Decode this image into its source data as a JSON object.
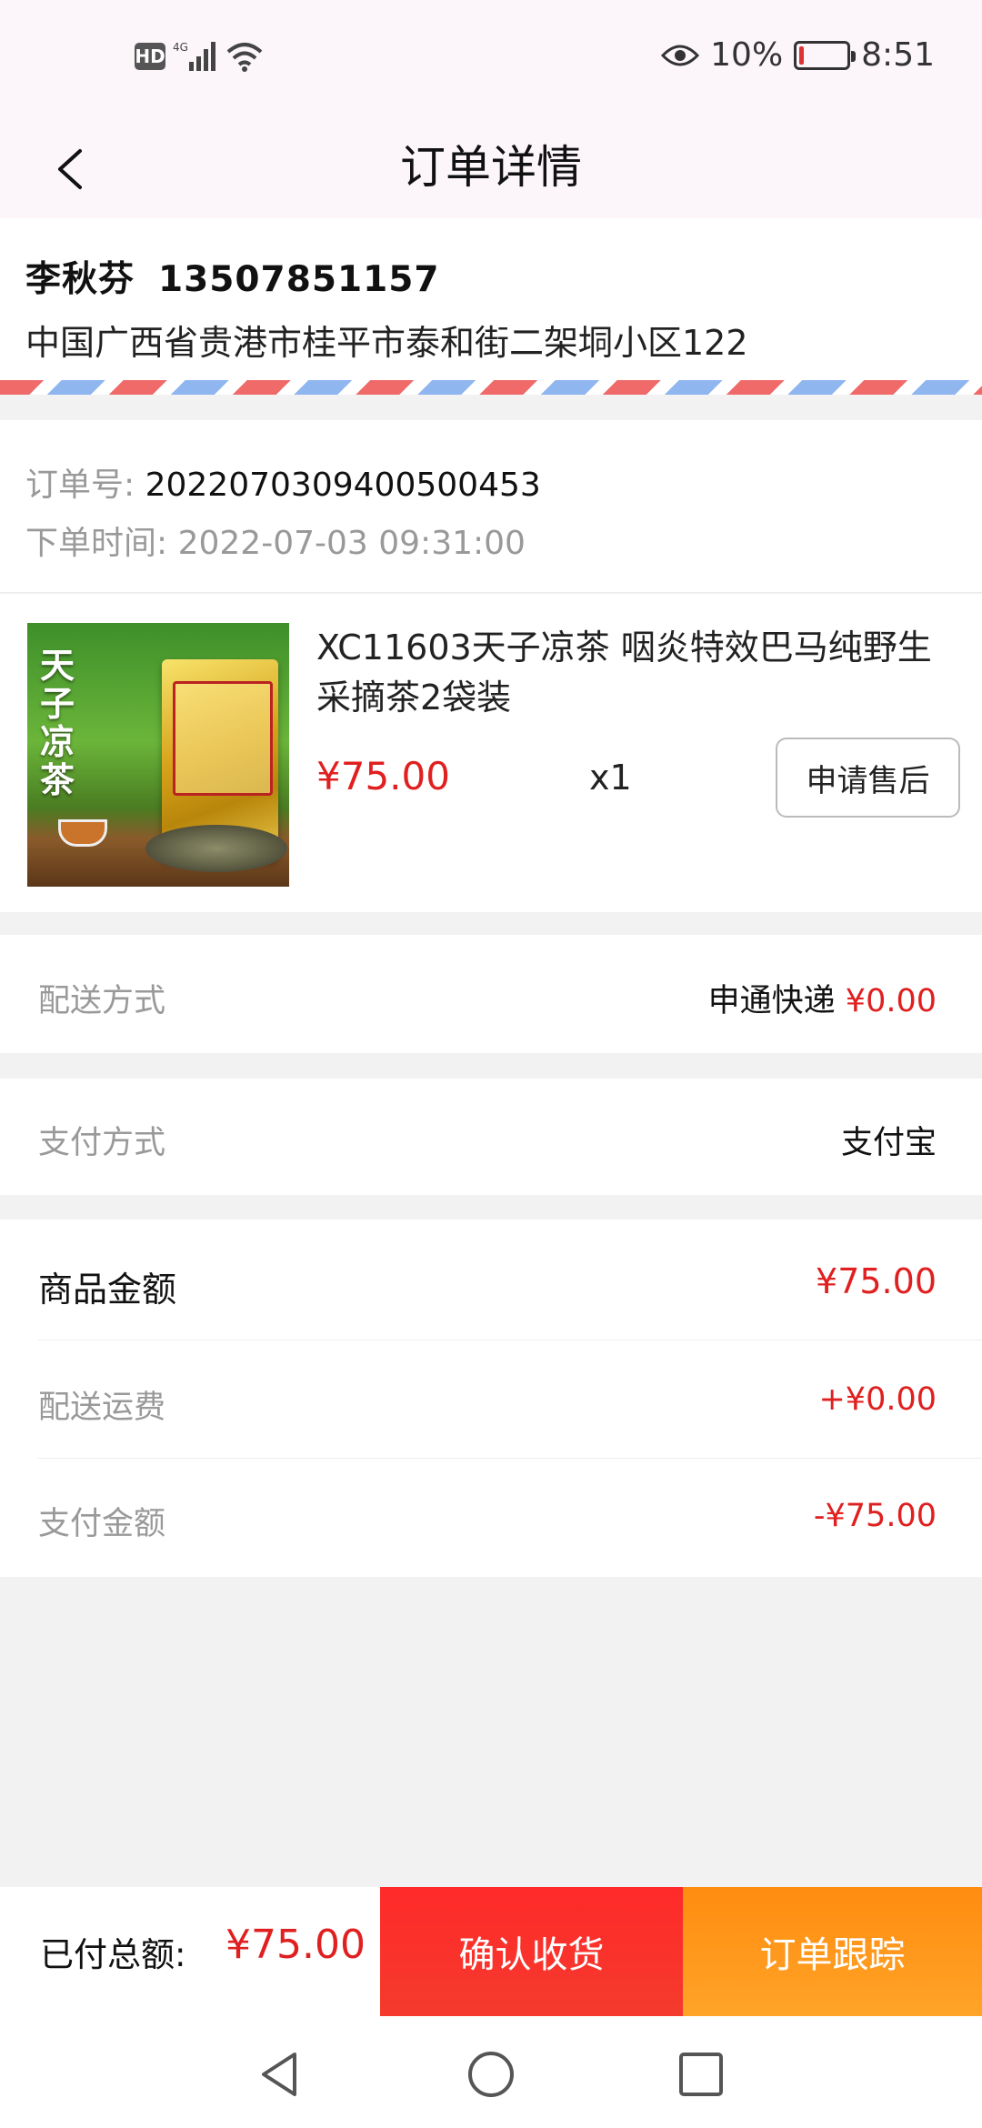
{
  "status_bar": {
    "hd": "HD",
    "network": "4G",
    "battery": "10%",
    "time": "8:51",
    "battery_level": 0.1,
    "icons": [
      "signal-icon",
      "wifi-icon",
      "eye-icon",
      "battery-icon"
    ]
  },
  "header": {
    "title": "订单详情",
    "back_icon": "back-arrow-icon"
  },
  "address": {
    "name": "李秋芬",
    "phone": "13507851157",
    "line": "中国广西省贵港市桂平市泰和街二架垌小区122"
  },
  "order": {
    "number_label": "订单号:",
    "number": "20220703094005004​53",
    "time_label": "下单时间:",
    "time": "2022-07-03 09:31:00"
  },
  "product": {
    "name": "XC11603天子凉茶 咽炎特效巴马纯野生采摘茶2袋装",
    "price": "¥75.00",
    "qty": "x1",
    "aftersale_label": "申请售后",
    "image_text": "天子凉茶"
  },
  "delivery": {
    "label": "配送方式",
    "method": "申通快递",
    "fee": "¥0.00"
  },
  "payment": {
    "label": "支付方式",
    "method": "支付宝"
  },
  "summary": {
    "goods_label": "商品金额",
    "goods_value": "¥75.00",
    "shipping_label": "配送运费",
    "shipping_value": "+¥0.00",
    "paid_label": "支付金额",
    "paid_value": "-¥75.00"
  },
  "footer": {
    "total_label": "已付总额:",
    "total_value": "¥75.00",
    "confirm_label": "确认收货",
    "track_label": "订单跟踪"
  },
  "nav": {
    "icons": [
      "nav-back-icon",
      "nav-home-icon",
      "nav-recents-icon"
    ]
  },
  "colors": {
    "accent_red": "#e02020",
    "button_red": "#ff2a2a",
    "button_orange": "#ff8c10",
    "airmail_red": "#f06a6a",
    "airmail_blue": "#8fb6ef"
  }
}
